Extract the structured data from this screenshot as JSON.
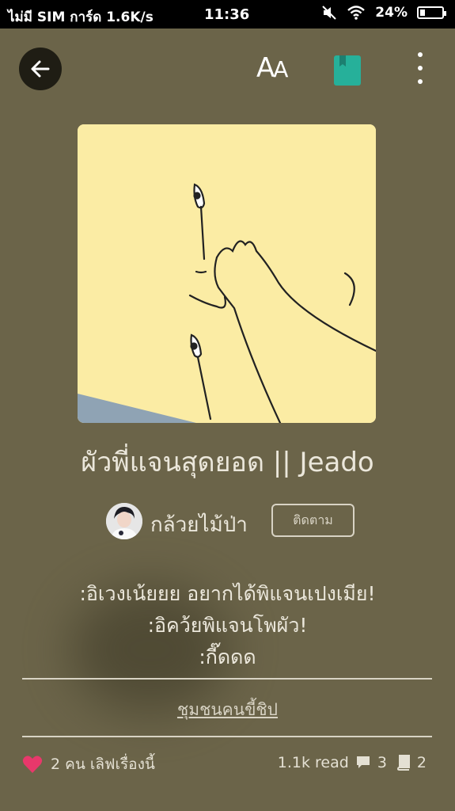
{
  "status_bar": {
    "carrier": "ไม่มี SIM การ์ด 1.6K/s",
    "time": "11:36",
    "battery_percent": "24%",
    "battery_level": 0.24,
    "icons": [
      "mute-icon",
      "wifi-icon",
      "battery-icon"
    ]
  },
  "toolbar": {
    "back_icon": "arrow-left-icon",
    "font_label": "AA",
    "font_label_big": "A",
    "font_label_small": "A",
    "bookmark_icon": "bookmark-icon",
    "bookmark_color": "#26b09a",
    "more_icon": "more-vertical-icon"
  },
  "story": {
    "title": "ผัวพี่แจนสุดยอด || Jeado",
    "author": "กล้วยไม้ป่า",
    "follow_label": "ติดตาม",
    "description": [
      ":อิเวงเน้ยยย อยากได้พิแจนเปงเมีย!",
      ":อิคว้ยพิแจนโพผัว!",
      ":กี๊ดดด"
    ],
    "community_link": "ชุมชนคนขี้ชิป"
  },
  "footer": {
    "likes_text": "2 คน เลิฟเรื่องนี้",
    "reads": "1.1k read",
    "comments": "3",
    "parts": "2",
    "heart_color": "#e8386b"
  }
}
